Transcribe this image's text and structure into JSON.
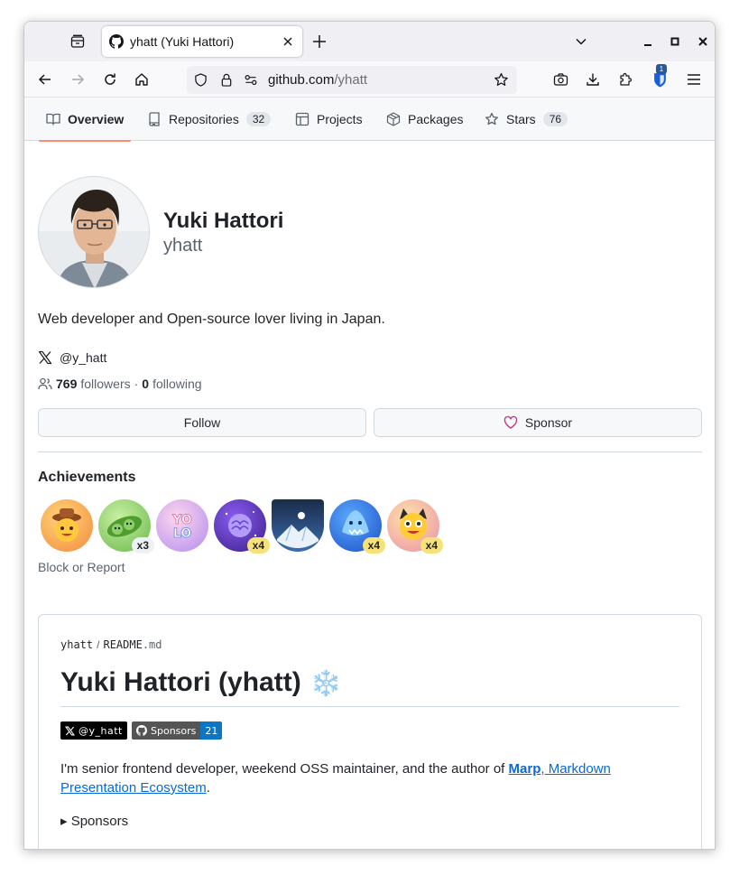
{
  "browser": {
    "tab_title": "yhatt (Yuki Hattori)",
    "url_host": "github.com",
    "url_path": "/yhatt",
    "extension_badge": "1"
  },
  "profile_nav": {
    "tabs": [
      {
        "label": "Overview",
        "count": null,
        "selected": true,
        "icon": "book-icon"
      },
      {
        "label": "Repositories",
        "count": "32",
        "selected": false,
        "icon": "repo-icon"
      },
      {
        "label": "Projects",
        "count": null,
        "selected": false,
        "icon": "table-icon"
      },
      {
        "label": "Packages",
        "count": null,
        "selected": false,
        "icon": "package-icon"
      },
      {
        "label": "Stars",
        "count": "76",
        "selected": false,
        "icon": "star-icon"
      }
    ]
  },
  "profile": {
    "name": "Yuki Hattori",
    "login": "yhatt",
    "bio": "Web developer and Open-source lover living in Japan.",
    "social_handle": "@y_hatt",
    "followers_count": "769",
    "followers_label": "followers",
    "separator": "·",
    "following_count": "0",
    "following_label": "following",
    "follow_button": "Follow",
    "sponsor_button": "Sponsor"
  },
  "achievements": {
    "title": "Achievements",
    "badges": [
      {
        "name": "starstruck-badge",
        "multiplier": null
      },
      {
        "name": "pair-extraordinaire-badge",
        "multiplier": "x3"
      },
      {
        "name": "yolo-badge",
        "multiplier": null
      },
      {
        "name": "galaxy-brain-badge",
        "multiplier": "x4"
      },
      {
        "name": "arctic-code-vault-badge",
        "multiplier": null
      },
      {
        "name": "pull-shark-badge",
        "multiplier": "x4"
      },
      {
        "name": "quickdraw-badge",
        "multiplier": "x4"
      }
    ],
    "block_link": "Block or Report"
  },
  "readme": {
    "owner": "yhatt",
    "path_sep": "/",
    "file_base": "README",
    "file_ext": ".md",
    "heading": "Yuki Hattori (yhatt)",
    "heading_emoji": "❄️",
    "shield_x": "@y_hatt",
    "shield_sponsors_label": "Sponsors",
    "shield_sponsors_count": "21",
    "para_text": "I'm senior frontend developer, weekend OSS maintainer, and the author of ",
    "link_bold": "Marp",
    "link_rest": ", Markdown Presentation Ecosystem",
    "para_end": ".",
    "details_summary": "▸ Sponsors"
  },
  "colors": {
    "selected_tab_underline": "#fd8c73",
    "link": "#0969da",
    "sponsor_heart": "#bf3989"
  }
}
